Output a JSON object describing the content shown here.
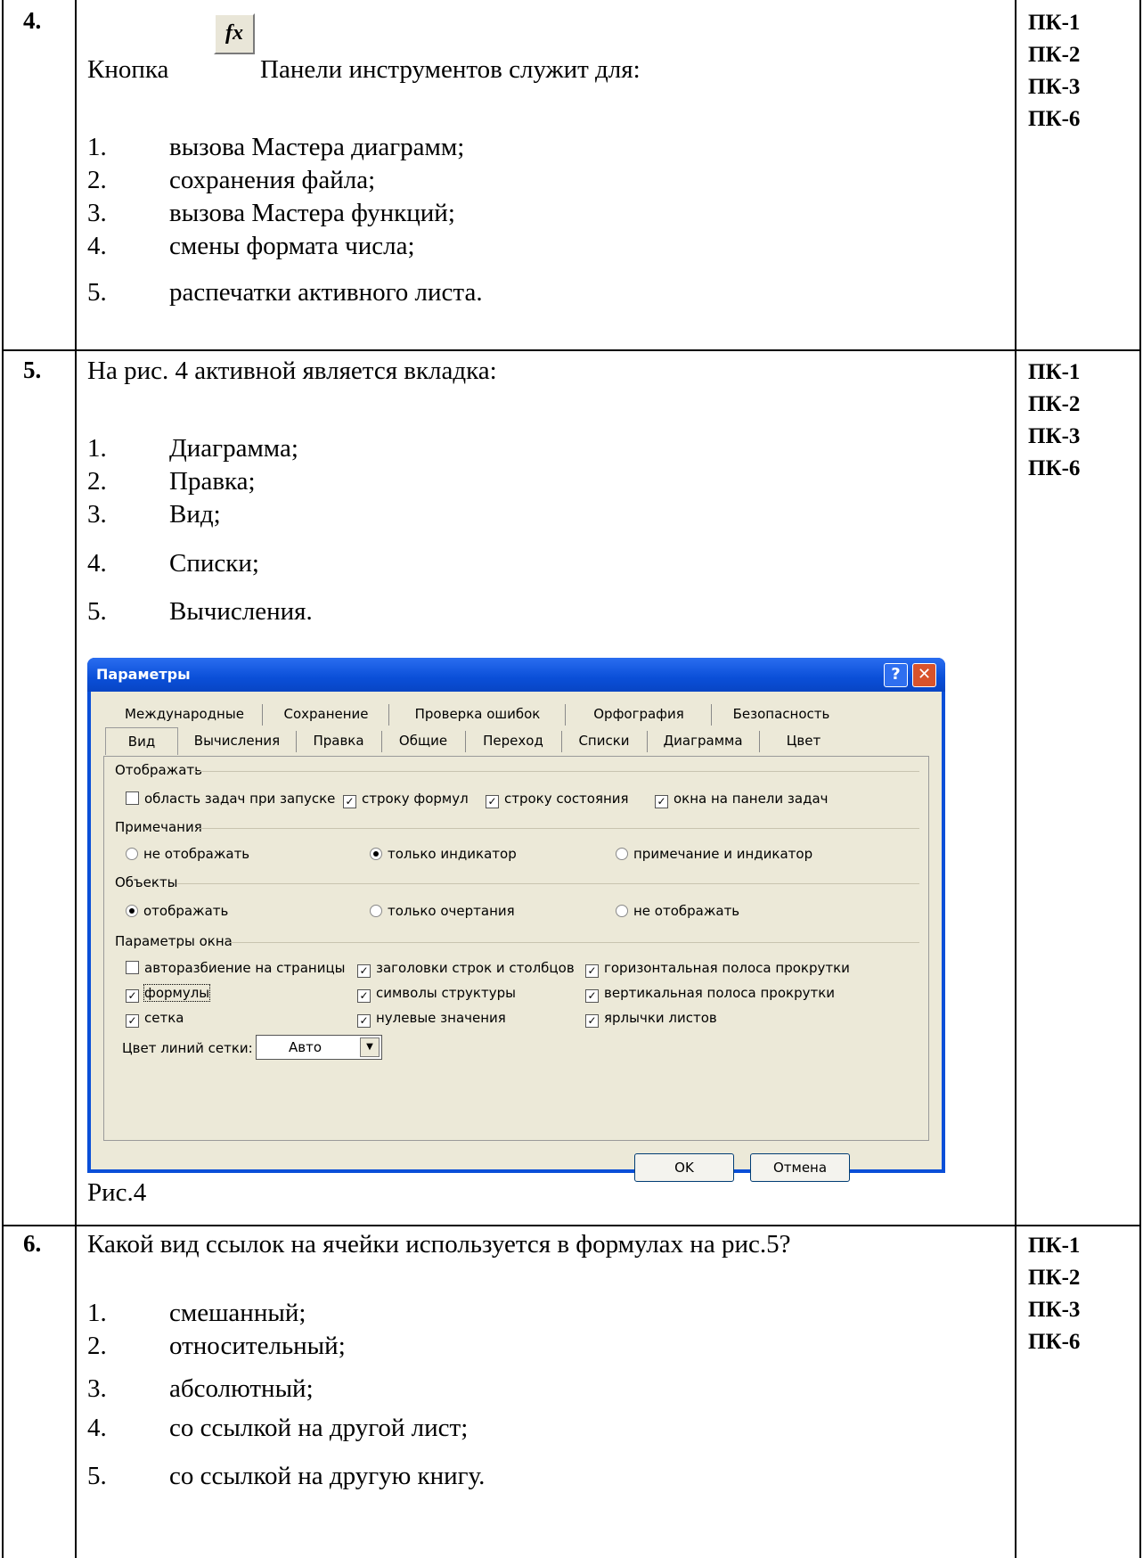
{
  "rows": [
    {
      "number": "4.",
      "question_before": "Кнопка",
      "button_glyph": "fx",
      "question_after": "Панели инструментов служит для:",
      "options": [
        {
          "n": "1.",
          "text": "вызова Мастера диаграмм;"
        },
        {
          "n": "2.",
          "text": "сохранения файла;"
        },
        {
          "n": "3.",
          "text": "вызова Мастера функций;"
        },
        {
          "n": "4.",
          "text": "смены формата числа;"
        },
        {
          "n": "5.",
          "text": "распечатки активного листа."
        }
      ],
      "competencies": [
        "ПК-1",
        "ПК-2",
        "ПК-3",
        "ПК-6"
      ]
    },
    {
      "number": "5.",
      "question": "На рис. 4 активной является вкладка:",
      "options": [
        {
          "n": "1.",
          "text": "Диаграмма;"
        },
        {
          "n": "2.",
          "text": "Правка;"
        },
        {
          "n": "3.",
          "text": "Вид;"
        },
        {
          "n": "4.",
          "text": "Списки;"
        },
        {
          "n": "5.",
          "text": "Вычисления."
        }
      ],
      "caption": "Рис.4",
      "competencies": [
        "ПК-1",
        "ПК-2",
        "ПК-3",
        "ПК-6"
      ]
    },
    {
      "number": "6.",
      "question": "Какой вид ссылок на ячейки используется в формулах на рис.5?",
      "options": [
        {
          "n": "1.",
          "text": "смешанный;"
        },
        {
          "n": "2.",
          "text": "относительный;"
        },
        {
          "n": "3.",
          "text": "абсолютный;"
        },
        {
          "n": "4.",
          "text": "со ссылкой на другой лист;"
        },
        {
          "n": "5.",
          "text": "со ссылкой на другую книгу."
        }
      ],
      "competencies": [
        "ПК-1",
        "ПК-2",
        "ПК-3",
        "ПК-6"
      ]
    }
  ],
  "dialog": {
    "title": "Параметры",
    "help_glyph": "?",
    "close_glyph": "✕",
    "tabs_row1": [
      "Международные",
      "Сохранение",
      "Проверка ошибок",
      "Орфография",
      "Безопасность"
    ],
    "tabs_row2": [
      "Вид",
      "Вычисления",
      "Правка",
      "Общие",
      "Переход",
      "Списки",
      "Диаграмма",
      "Цвет"
    ],
    "active_tab": "Вид",
    "groups": {
      "display": "Отображать",
      "notes": "Примечания",
      "objects": "Объекты",
      "window": "Параметры окна"
    },
    "display_checks": [
      {
        "label": "область задач при запуске",
        "checked": false
      },
      {
        "label": "строку формул",
        "checked": true
      },
      {
        "label": "строку состояния",
        "checked": true
      },
      {
        "label": "окна на панели задач",
        "checked": true
      }
    ],
    "notes_radios": [
      {
        "label": "не отображать",
        "selected": false
      },
      {
        "label": "только индикатор",
        "selected": true
      },
      {
        "label": "примечание и индикатор",
        "selected": false
      }
    ],
    "objects_radios": [
      {
        "label": "отображать",
        "selected": true
      },
      {
        "label": "только очертания",
        "selected": false
      },
      {
        "label": "не отображать",
        "selected": false
      }
    ],
    "window_checks": [
      {
        "label": "авторазбиение на страницы",
        "checked": false
      },
      {
        "label": "заголовки строк и столбцов",
        "checked": true
      },
      {
        "label": "горизонтальная полоса прокрутки",
        "checked": true
      },
      {
        "label": "формулы",
        "checked": true
      },
      {
        "label": "символы структуры",
        "checked": true
      },
      {
        "label": "вертикальная полоса прокрутки",
        "checked": true
      },
      {
        "label": "сетка",
        "checked": true
      },
      {
        "label": "нулевые значения",
        "checked": true
      },
      {
        "label": "ярлычки листов",
        "checked": true
      }
    ],
    "gridline_color_label": "Цвет линий сетки:",
    "gridline_color_value": "Авто",
    "ok_label": "OK",
    "cancel_label": "Отмена"
  }
}
